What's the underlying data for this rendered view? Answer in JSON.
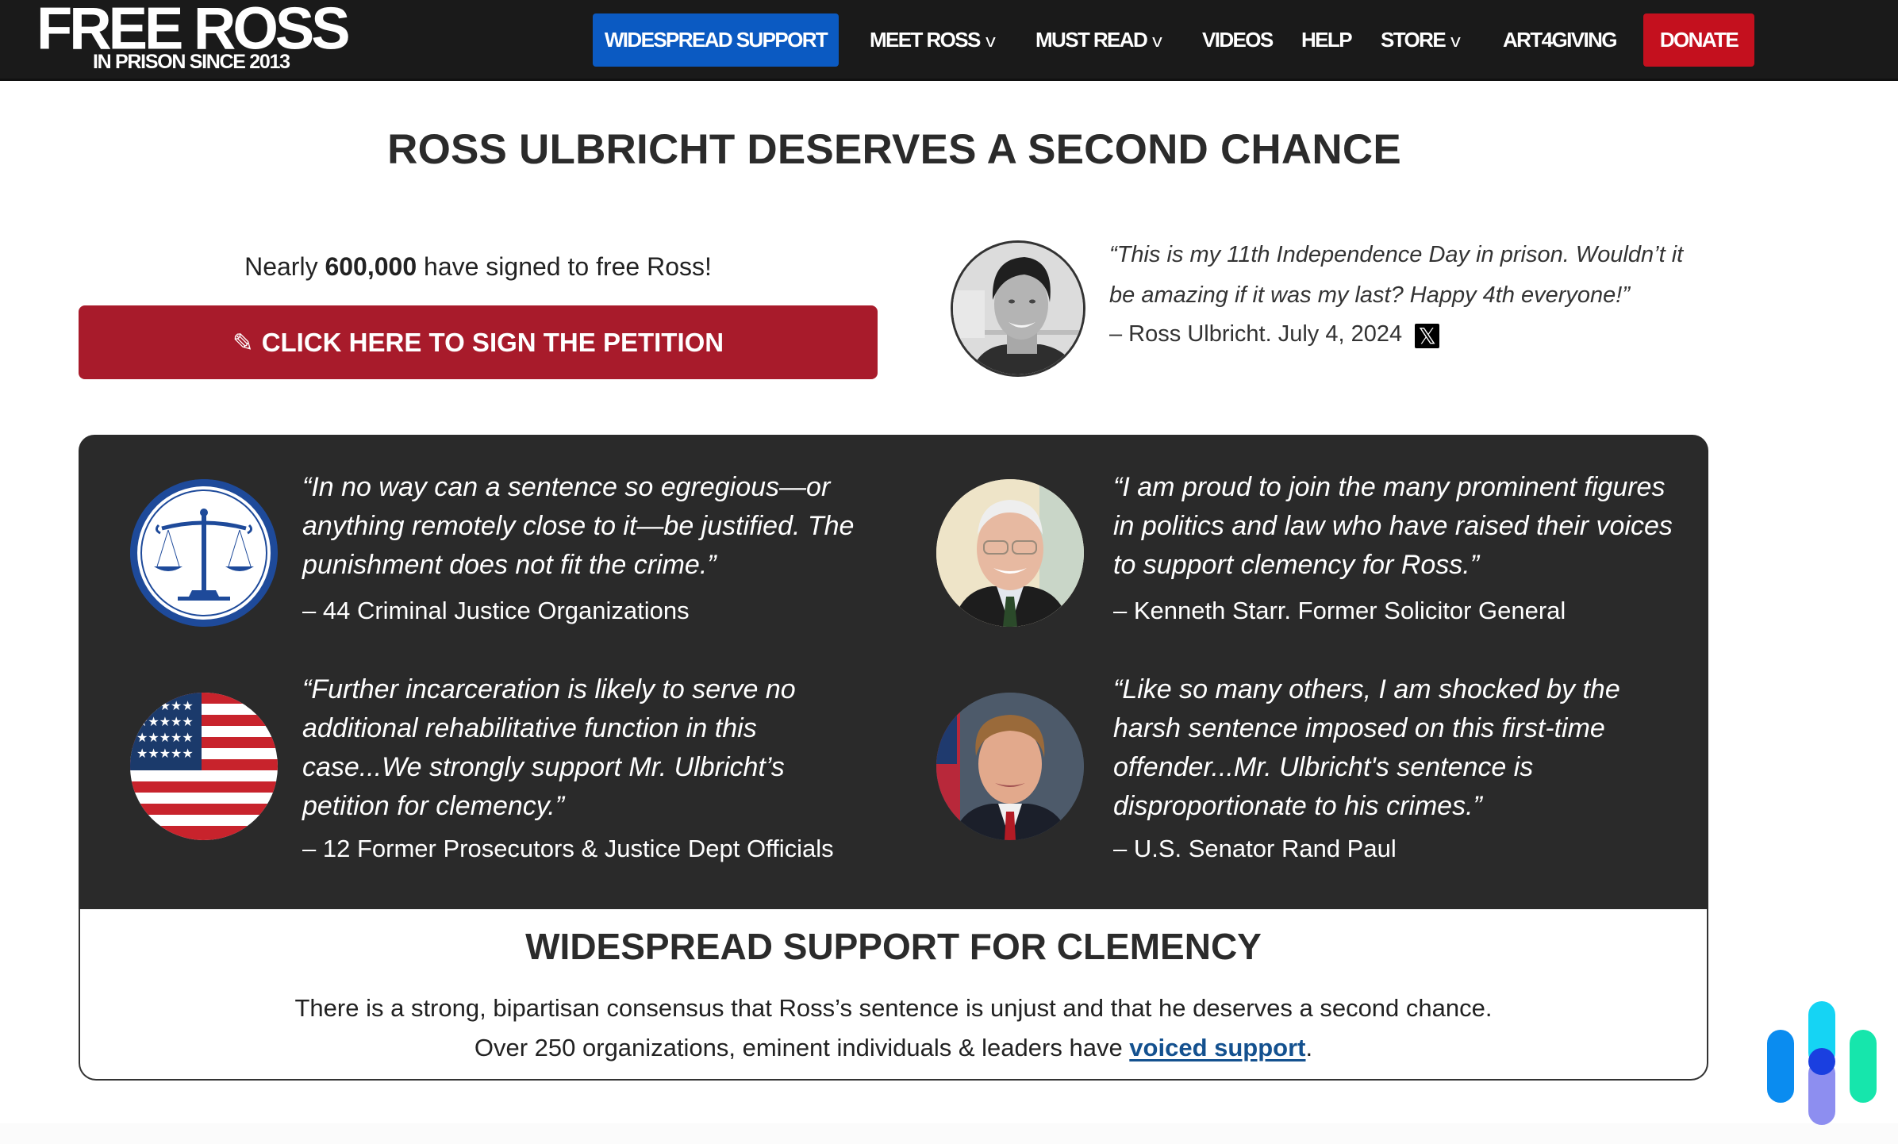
{
  "nav": {
    "logo_title": "FREE ROSS",
    "logo_subtitle": "IN PRISON SINCE 2013",
    "items": [
      {
        "label": "WIDESPREAD SUPPORT",
        "has_dropdown": false,
        "highlight": "#0b5ac2"
      },
      {
        "label": "MEET ROSS",
        "has_dropdown": true
      },
      {
        "label": "MUST READ",
        "has_dropdown": true
      },
      {
        "label": "VIDEOS",
        "has_dropdown": false
      },
      {
        "label": "HELP",
        "has_dropdown": false
      },
      {
        "label": "STORE",
        "has_dropdown": true
      },
      {
        "label": "ART4GIVING",
        "has_dropdown": false
      },
      {
        "label": "DONATE",
        "has_dropdown": false,
        "highlight": "#c4101e"
      }
    ],
    "chevron_glyph": "v"
  },
  "hero": {
    "headline": "ROSS ULBRICHT DESERVES A SECOND CHANCE",
    "signed_prefix": "Nearly ",
    "signed_count": "600,000",
    "signed_suffix": " have signed to free Ross!",
    "petition_icon": "pencil-icon",
    "petition_glyph": "✎",
    "petition_label": "CLICK HERE TO SIGN THE PETITION",
    "petition_color": "#a81b2b",
    "ross_quote": "“This is my 11th Independence Day in prison. Wouldn’t it be amazing if it was my last? Happy 4th everyone!”",
    "ross_attribution": "– Ross Ulbricht. July 4, 2024",
    "x_glyph": "𝕏"
  },
  "support_quotes": [
    {
      "icon": "scales-of-justice",
      "quote": "“In no way can a sentence so egregious—or anything remotely close to it—be justified. The punishment does not fit the crime.”",
      "attribution": "– 44 Criminal Justice Organizations"
    },
    {
      "icon": "kenneth-starr-portrait",
      "quote": "“I am proud to join the many prominent figures in politics and law who have raised their voices to support clemency for Ross.”",
      "attribution": "–  Kenneth Starr. Former Solicitor General"
    },
    {
      "icon": "american-flag",
      "quote": "“Further incarceration is likely to serve no additional rehabilitative function in this case...We strongly support Mr. Ulbricht’s petition for clemency.”",
      "attribution": "– 12 Former Prosecutors & Justice Dept Officials"
    },
    {
      "icon": "rand-paul-portrait",
      "quote": "“Like so many others, I am shocked by the harsh sentence imposed on this first-time offender...Mr. Ulbricht's sentence is disproportionate to his crimes.”",
      "attribution": "– U.S. Senator Rand Paul"
    }
  ],
  "support_box": {
    "title": "WIDESPREAD SUPPORT FOR CLEMENCY",
    "line1": "There is a strong, bipartisan consensus that Ross’s sentence is unjust and that he deserves a second chance.",
    "line2_prefix": "Over 250 organizations, eminent individuals & leaders have ",
    "line2_link": "voiced support",
    "line2_suffix": "."
  },
  "colors": {
    "nav_bg": "#1a1a1a",
    "panel_bg": "#2a2a2a",
    "link": "#14518f"
  }
}
